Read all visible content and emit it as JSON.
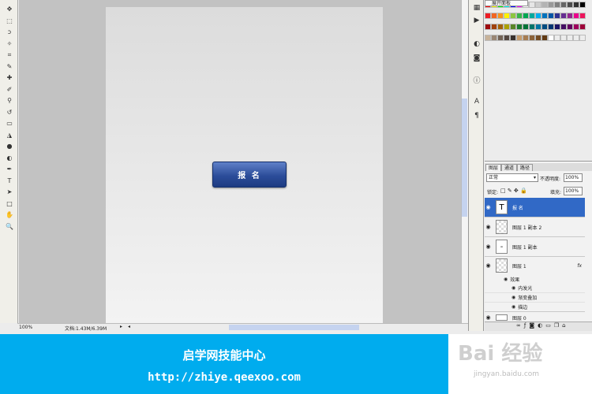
{
  "tools": [
    {
      "name": "move-tool",
      "glyph": "✥"
    },
    {
      "name": "marquee-tool",
      "glyph": "⬚"
    },
    {
      "name": "lasso-tool",
      "glyph": "ↄ"
    },
    {
      "name": "magic-wand-tool",
      "glyph": "✧"
    },
    {
      "name": "crop-tool",
      "glyph": "⌗"
    },
    {
      "name": "eyedropper-tool",
      "glyph": "✎"
    },
    {
      "name": "healing-brush-tool",
      "glyph": "✚"
    },
    {
      "name": "brush-tool",
      "glyph": "✐"
    },
    {
      "name": "clone-stamp-tool",
      "glyph": "⚲"
    },
    {
      "name": "history-brush-tool",
      "glyph": "↺"
    },
    {
      "name": "eraser-tool",
      "glyph": "▭"
    },
    {
      "name": "paint-bucket-tool",
      "glyph": "◮"
    },
    {
      "name": "blur-tool",
      "glyph": "●"
    },
    {
      "name": "dodge-tool",
      "glyph": "◐"
    },
    {
      "name": "pen-tool",
      "glyph": "✒"
    },
    {
      "name": "type-tool",
      "glyph": "T"
    },
    {
      "name": "path-selection-tool",
      "glyph": "➤"
    },
    {
      "name": "rectangle-tool",
      "glyph": "□"
    },
    {
      "name": "hand-tool",
      "glyph": "✋"
    },
    {
      "name": "zoom-tool",
      "glyph": "🔍"
    }
  ],
  "canvas": {
    "button_label": "报 名"
  },
  "status": {
    "zoom": "100%",
    "doc_info": "文档:1.43M/6.39M"
  },
  "swatches": {
    "tab_label": "展开面板",
    "colors": [
      "#ff0000",
      "#ffff00",
      "#00ff00",
      "#00ffff",
      "#0000ff",
      "#ff00ff",
      "#ffffff",
      "#e6e6e6",
      "#cccccc",
      "#b3b3b3",
      "#999999",
      "#808080",
      "#666666",
      "#4d4d4d",
      "#333333",
      "#000000",
      "#ed1c24",
      "#f26522",
      "#f7941d",
      "#fff200",
      "#8dc63f",
      "#39b54a",
      "#00a651",
      "#00a99d",
      "#00aeef",
      "#0072bc",
      "#0054a6",
      "#2e3192",
      "#662d91",
      "#92278f",
      "#ec008c",
      "#ed145b",
      "#9e0b0f",
      "#a0410d",
      "#a36209",
      "#aba000",
      "#598527",
      "#1a7b30",
      "#007236",
      "#00746b",
      "#0076a3",
      "#004b80",
      "#003471",
      "#1b1464",
      "#440e62",
      "#630460",
      "#9e005d",
      "#9e0039",
      "#c7b299",
      "#998675",
      "#736357",
      "#534741",
      "#37302d",
      "#c69c6d",
      "#a67c52",
      "#8c6239",
      "#754c24",
      "#603913",
      "#ffffff",
      "#ececec",
      "#ececec",
      "#ececec",
      "#ececec",
      "#ececec"
    ]
  },
  "layers": {
    "tabs": [
      "图层",
      "通道",
      "路径"
    ],
    "blend_mode": "正常",
    "opacity_label": "不透明度:",
    "opacity_value": "100%",
    "lock_label": "锁定:",
    "fill_label": "填充:",
    "fill_value": "100%",
    "items": [
      {
        "name": "报 名",
        "type": "text",
        "selected": true
      },
      {
        "name": "图层 1 副本 2",
        "type": "raster",
        "selected": false
      },
      {
        "name": "图层 1 副本",
        "type": "raster",
        "selected": false
      },
      {
        "name": "图层 1",
        "type": "raster",
        "selected": false,
        "fx": "fx"
      }
    ],
    "effects_label": "效果",
    "effects": [
      "内发光",
      "渐变叠加",
      "描边"
    ],
    "bottom_layer": "图层 0"
  },
  "banner": {
    "title": "启学网技能中心",
    "url": "http://zhiye.qeexoo.com"
  },
  "watermark": {
    "main": "Bai 经验",
    "sub": "jingyan.baidu.com"
  },
  "colors": {
    "accent": "#00acee",
    "button": "#2c4d9a",
    "selected_layer": "#3169c6"
  }
}
